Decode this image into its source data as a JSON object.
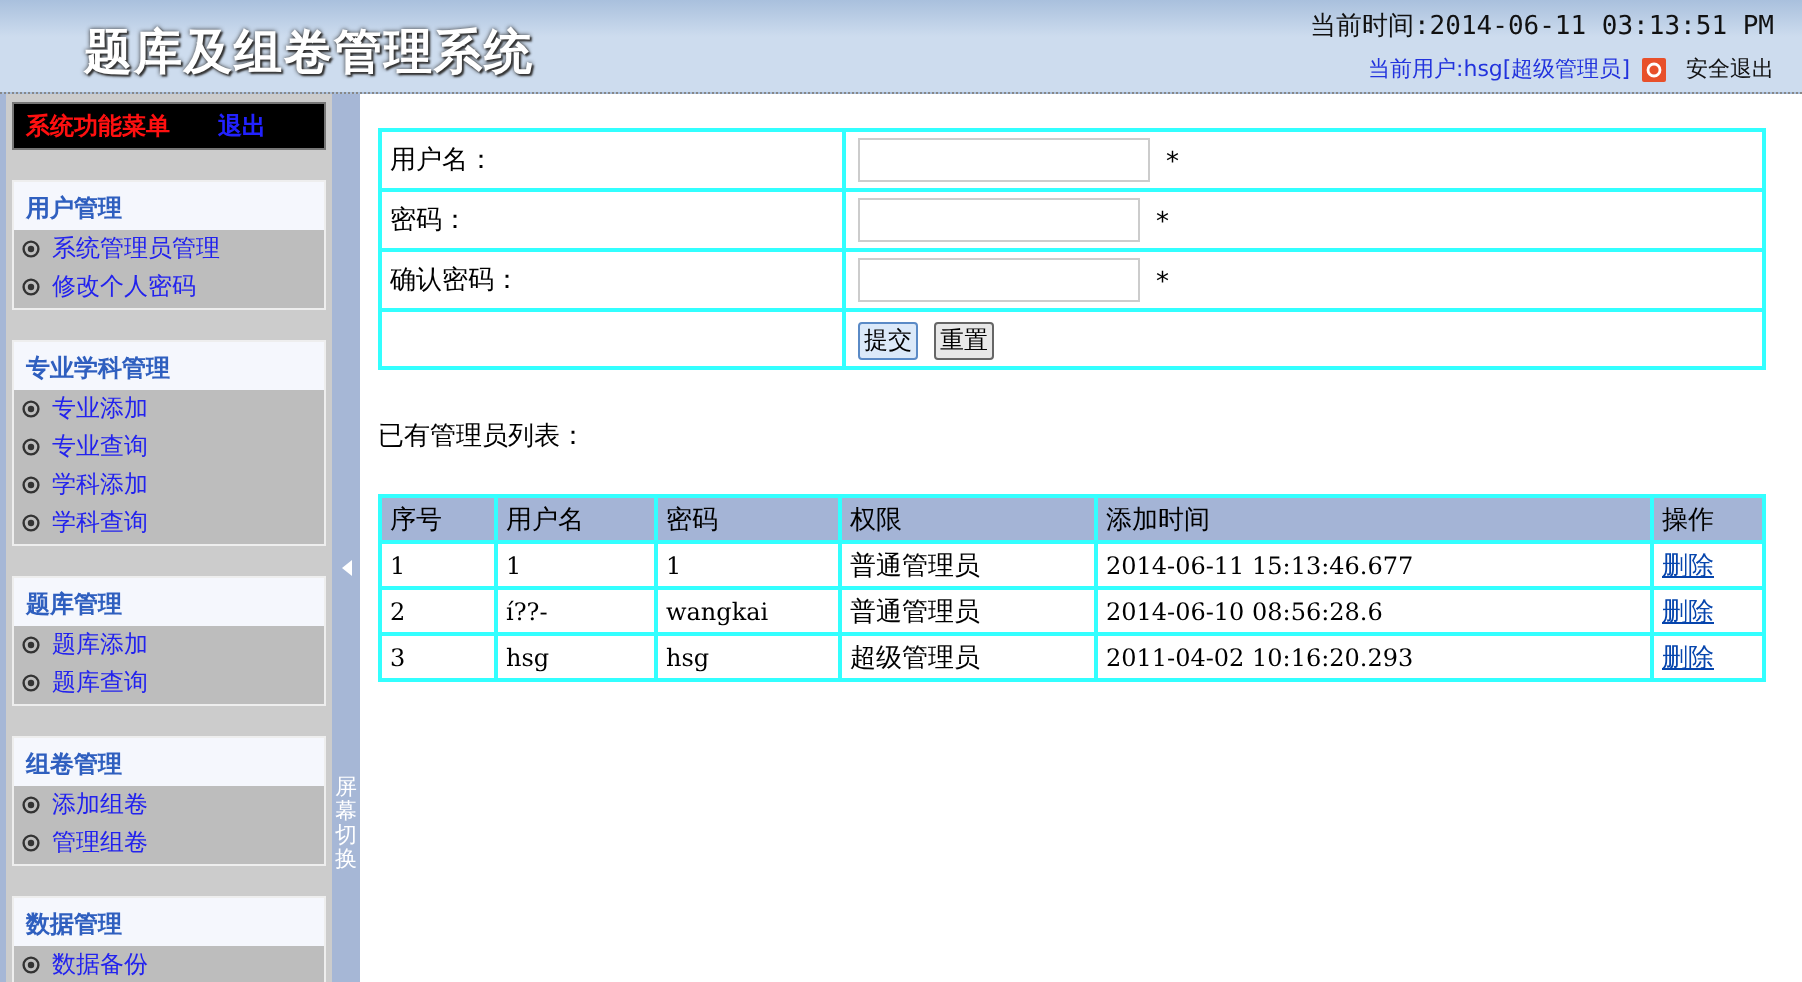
{
  "header": {
    "title": "题库及组卷管理系统",
    "current_time": "当前时间:2014-06-11 03:13:51 PM",
    "current_user": "当前用户:hsg[超级管理员]",
    "logout": "安全退出"
  },
  "sidebar": {
    "menu_title": "系统功能菜单",
    "exit": "退出",
    "groups": [
      {
        "title": "用户管理",
        "items": [
          "系统管理员管理",
          "修改个人密码"
        ]
      },
      {
        "title": "专业学科管理",
        "items": [
          "专业添加",
          "专业查询",
          "学科添加",
          "学科查询"
        ]
      },
      {
        "title": "题库管理",
        "items": [
          "题库添加",
          "题库查询"
        ]
      },
      {
        "title": "组卷管理",
        "items": [
          "添加组卷",
          "管理组卷"
        ]
      },
      {
        "title": "数据管理",
        "items": [
          "数据备份"
        ]
      }
    ]
  },
  "toggle": {
    "label": "屏幕切换"
  },
  "form": {
    "fields": [
      {
        "label": "用户名：",
        "mark": "*"
      },
      {
        "label": "密码：",
        "mark": "*"
      },
      {
        "label": "确认密码：",
        "mark": "*"
      }
    ],
    "buttons": [
      "提交",
      "重置"
    ]
  },
  "list_title": "已有管理员列表：",
  "table": {
    "columns": [
      "序号",
      "用户名",
      "密码",
      "权限",
      "添加时间",
      "操作"
    ],
    "rows": [
      {
        "cells": [
          "1",
          "1",
          "1",
          "普通管理员",
          "2014-06-11 15:13:46.677"
        ],
        "action": "删除"
      },
      {
        "cells": [
          "2",
          "í??-",
          "wangkai",
          "普通管理员",
          "2014-06-10 08:56:28.6"
        ],
        "action": "删除"
      },
      {
        "cells": [
          "3",
          "hsg",
          "hsg",
          "超级管理员",
          "2011-04-02 10:16:20.293"
        ],
        "action": "删除"
      }
    ]
  }
}
